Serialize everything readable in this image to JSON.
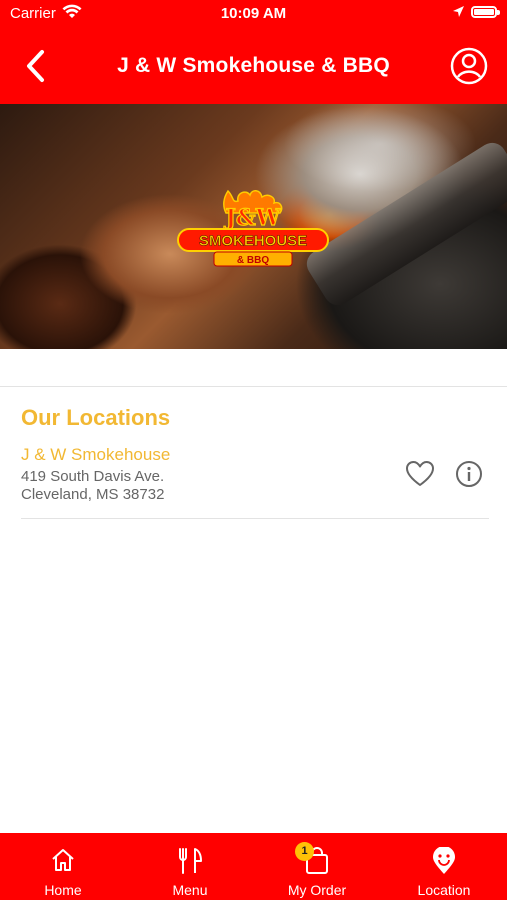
{
  "status_bar": {
    "carrier": "Carrier",
    "time": "10:09 AM"
  },
  "header": {
    "title": "J & W Smokehouse & BBQ"
  },
  "hero": {
    "logo_text_main": "SMOKEHOUSE",
    "logo_text_sub": "& BBQ",
    "logo_monogram": "J&W"
  },
  "locations": {
    "title": "Our Locations",
    "items": [
      {
        "name": "J & W Smokehouse",
        "address_line1": "419 South Davis Ave.",
        "address_line2": "Cleveland, MS 38732"
      }
    ]
  },
  "tabbar": {
    "items": [
      {
        "label": "Home",
        "icon": "home-icon"
      },
      {
        "label": "Menu",
        "icon": "fork-knife-icon"
      },
      {
        "label": "My Order",
        "icon": "bag-icon",
        "badge": "1"
      },
      {
        "label": "Location",
        "icon": "location-pin-icon"
      }
    ]
  },
  "colors": {
    "brand_red": "#ff0000",
    "accent_gold": "#f2b833",
    "badge_yellow": "#ffc107"
  }
}
